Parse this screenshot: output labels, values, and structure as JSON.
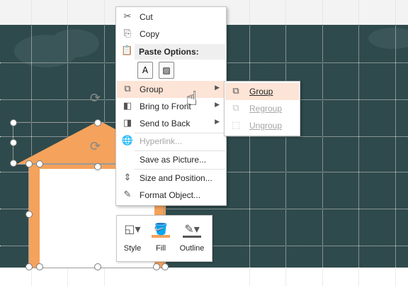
{
  "context_menu": {
    "items": [
      {
        "label": "Cut",
        "icon": "scissors-icon",
        "glyph": "✂",
        "disabled": false
      },
      {
        "label": "Copy",
        "icon": "copy-icon",
        "glyph": "⎘",
        "disabled": false
      }
    ],
    "paste_options_label": "Paste Options:",
    "paste_icons": [
      {
        "icon": "paste-keep-text-icon",
        "glyph": "A"
      },
      {
        "icon": "paste-picture-icon",
        "glyph": "▨"
      }
    ],
    "group_label": "Group",
    "bring_to_front_label": "Bring to Front",
    "send_to_back_label": "Send to Back",
    "hyperlink_label": "Hyperlink...",
    "save_as_picture_label": "Save as Picture...",
    "size_position_label": "Size and Position...",
    "format_object_label": "Format Object..."
  },
  "submenu": {
    "group_label": "Group",
    "regroup_label": "Regroup",
    "ungroup_label": "Ungroup"
  },
  "mini_toolbar": {
    "style_label": "Style",
    "fill_label": "Fill",
    "outline_label": "Outline"
  },
  "colors": {
    "slide_background": "#2f4a4c",
    "house_orange": "#f4a25c",
    "hover_highlight": "#fce4d6"
  }
}
